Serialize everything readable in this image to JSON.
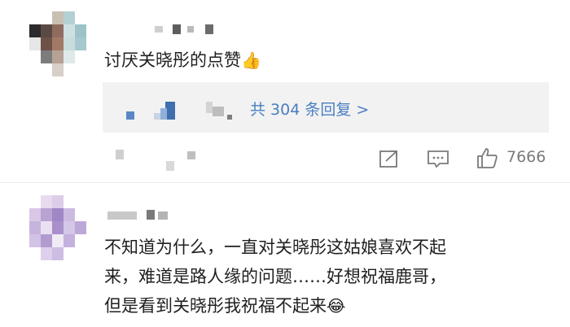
{
  "comment1": {
    "text": "讨厌关晓彤的点赞",
    "emoji": "👍",
    "replies_link": "共 304 条回复 >",
    "like_count": "7666",
    "icons": [
      "share-icon",
      "comment-icon",
      "like-icon"
    ]
  },
  "comment2": {
    "line1": "不知道为什么，一直对关晓彤这姑娘喜欢不起",
    "line2": "来，难道是路人缘的问题……好想祝福鹿哥，",
    "line3": "但是看到关晓彤我祝福不起来",
    "emoji": "😂"
  },
  "colors": {
    "link": "#4a7fc1",
    "muted": "#7a7a7a",
    "reply_bg": "#f2f2f2"
  }
}
